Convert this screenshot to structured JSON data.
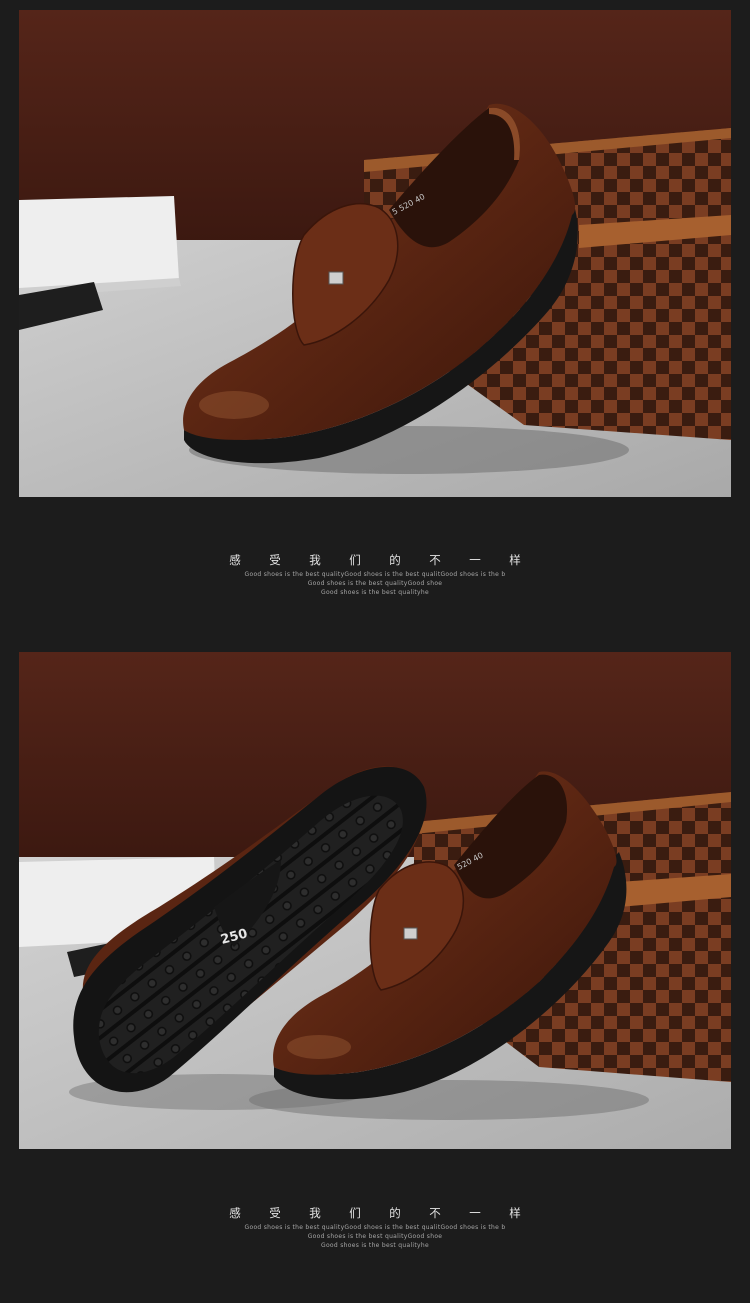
{
  "section1": {
    "photo_label": "Brown leather slip-on shoe on marble floor with checkered box",
    "insole_text": "5 520 40",
    "caption": {
      "heading_chars": [
        "感",
        "受",
        "我",
        "们",
        "的",
        "不",
        "一",
        "样"
      ],
      "lines": [
        "Good shoes is the best qualityGood shoes is the best qualitGood shoes is the b",
        "Good shoes is the best qualityGood shoe",
        "Good shoes is the best qualityhe"
      ]
    }
  },
  "section2": {
    "photo_label": "Pair of brown leather shoes showing rubber outsole",
    "sole_size_text": "250",
    "insole_text": "520 40",
    "caption": {
      "heading_chars": [
        "感",
        "受",
        "我",
        "们",
        "的",
        "不",
        "一",
        "样"
      ],
      "lines": [
        "Good shoes is the best qualityGood shoes is the best qualitGood shoes is the b",
        "Good shoes is the best qualityGood shoe",
        "Good shoes is the best qualityhe"
      ]
    }
  },
  "colors": {
    "page_bg": "#1c1c1c",
    "wall": "#4a1f15",
    "floor": "#bfbfbf",
    "leather": "#5a2412",
    "sole": "#1a1a1a"
  }
}
